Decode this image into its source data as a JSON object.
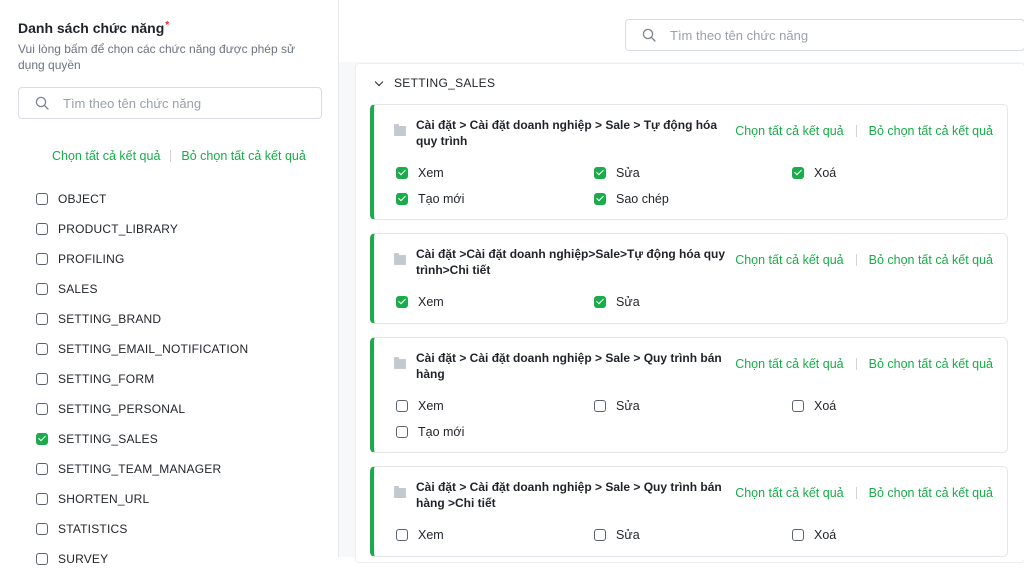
{
  "left": {
    "title": "Danh sách chức năng",
    "required_mark": "*",
    "description": "Vui lòng bấm để chọn các chức năng được phép sử dụng quyền",
    "search_placeholder": "Tìm theo tên chức năng",
    "select_all": "Chọn tất cả kết quả",
    "deselect_all": "Bỏ chọn tất cả kết quả",
    "items": [
      {
        "label": "OBJECT",
        "checked": false
      },
      {
        "label": "PRODUCT_LIBRARY",
        "checked": false
      },
      {
        "label": "PROFILING",
        "checked": false
      },
      {
        "label": "SALES",
        "checked": false
      },
      {
        "label": "SETTING_BRAND",
        "checked": false
      },
      {
        "label": "SETTING_EMAIL_NOTIFICATION",
        "checked": false
      },
      {
        "label": "SETTING_FORM",
        "checked": false
      },
      {
        "label": "SETTING_PERSONAL",
        "checked": false
      },
      {
        "label": "SETTING_SALES",
        "checked": true
      },
      {
        "label": "SETTING_TEAM_MANAGER",
        "checked": false
      },
      {
        "label": "SHORTEN_URL",
        "checked": false
      },
      {
        "label": "STATISTICS",
        "checked": false
      },
      {
        "label": "SURVEY",
        "checked": false
      }
    ]
  },
  "right": {
    "search_placeholder": "Tìm theo tên chức năng",
    "group_title": "SETTING_SALES",
    "select_all": "Chọn tất cả kết quả",
    "deselect_all": "Bỏ chọn tất cả kết quả",
    "cards": [
      {
        "path": "Cài đặt > Cài đặt doanh nghiệp > Sale > Tự động hóa quy trình",
        "perms": [
          {
            "label": "Xem",
            "checked": true
          },
          {
            "label": "Sửa",
            "checked": true
          },
          {
            "label": "Xoá",
            "checked": true
          },
          {
            "label": "Tạo mới",
            "checked": true
          },
          {
            "label": "Sao chép",
            "checked": true
          }
        ]
      },
      {
        "path": "Cài đặt >Cài đặt doanh nghiệp>Sale>Tự động hóa quy trình>Chi tiết",
        "perms": [
          {
            "label": "Xem",
            "checked": true
          },
          {
            "label": "Sửa",
            "checked": true
          }
        ]
      },
      {
        "path": "Cài đặt > Cài đặt doanh nghiệp > Sale > Quy trình bán hàng",
        "perms": [
          {
            "label": "Xem",
            "checked": false
          },
          {
            "label": "Sửa",
            "checked": false
          },
          {
            "label": "Xoá",
            "checked": false
          },
          {
            "label": "Tạo mới",
            "checked": false
          }
        ]
      },
      {
        "path": "Cài đặt > Cài đặt doanh nghiệp > Sale > Quy trình bán hàng >Chi tiết",
        "perms": [
          {
            "label": "Xem",
            "checked": false
          },
          {
            "label": "Sửa",
            "checked": false
          },
          {
            "label": "Xoá",
            "checked": false
          }
        ]
      }
    ]
  },
  "colors": {
    "accent": "#1aab4b",
    "required": "#f5222d"
  },
  "icons": [
    "search-icon",
    "chevron-down-icon",
    "folder-icon",
    "checkbox-icon"
  ]
}
